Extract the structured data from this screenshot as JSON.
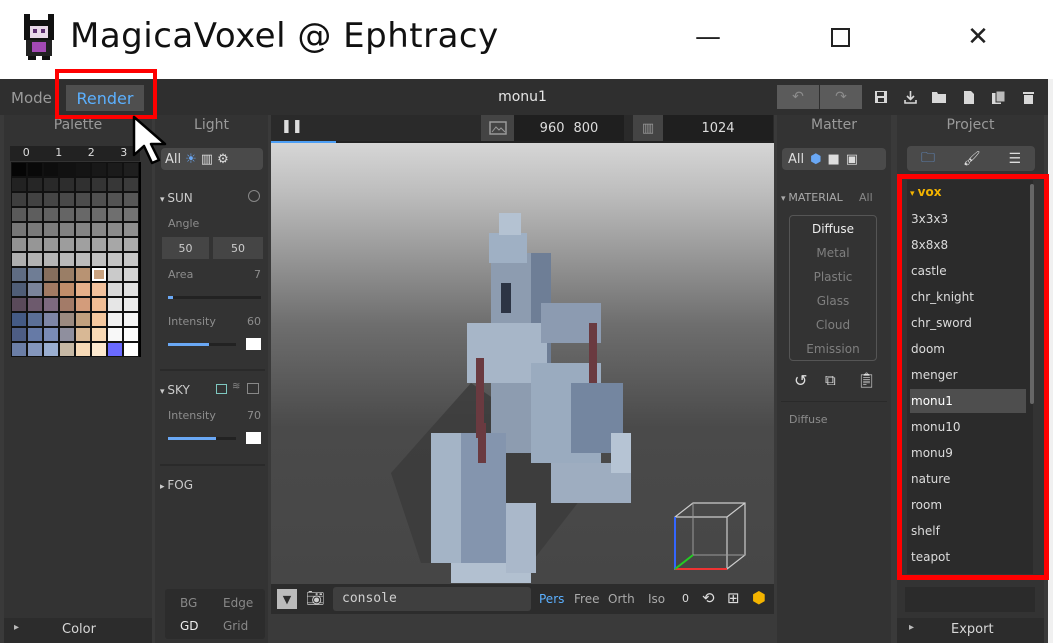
{
  "window": {
    "title": "MagicaVoxel @ Ephtracy",
    "min_icon": "minimize-icon",
    "max_icon": "maximize-icon",
    "close_icon": "close-icon"
  },
  "topbar": {
    "mode_label": "Mode",
    "render_label": "Render",
    "doc_title": "monu1",
    "toolbar_icons": [
      "undo-icon",
      "redo-icon",
      "save-icon",
      "download-icon",
      "folder-icon",
      "new-file-icon",
      "copy-file-icon",
      "trash-icon"
    ]
  },
  "palette": {
    "title": "Palette",
    "page_numbers": [
      "0",
      "1",
      "2",
      "3"
    ],
    "footer_label": "Color",
    "colors": [
      "#050505",
      "#090909",
      "#0d0d0d",
      "#111",
      "#141414",
      "#181818",
      "#1b1b1b",
      "#1f1f1f",
      "#222",
      "#262626",
      "#292929",
      "#2d2d2d",
      "#303030",
      "#343434",
      "#373737",
      "#3b3b3b",
      "#3e3e3e",
      "#424242",
      "#454545",
      "#494949",
      "#4c4c4c",
      "#505050",
      "#535353",
      "#575757",
      "#5a5a5a",
      "#5e5e5e",
      "#616161",
      "#656565",
      "#686868",
      "#6c6c6c",
      "#6f6f6f",
      "#737373",
      "#767676",
      "#7a7a7a",
      "#7d7d7d",
      "#818181",
      "#848484",
      "#888",
      "#8b8b8b",
      "#8f8f8f",
      "#929292",
      "#969696",
      "#999",
      "#9d9d9d",
      "#a0a0a0",
      "#a4a4a4",
      "#a7a7a7",
      "#ababab",
      "#aeaeae",
      "#b2b2b2",
      "#b5b5b5",
      "#b9b9b9",
      "#bcbcbc",
      "#c0c0c0",
      "#c3c3c3",
      "#c7c7c7",
      "#5f6c82",
      "#6f7d95",
      "#866e5d",
      "#9a7e66",
      "#b89373",
      "#c9a27f",
      "#cacaca",
      "#d4d4d4",
      "#4f5d76",
      "#7b849a",
      "#a27a63",
      "#c08d6a",
      "#e6b08a",
      "#f2c19c",
      "#d9d9d9",
      "#e0e0e0",
      "#5a4a5a",
      "#6d5a6d",
      "#7d6a7f",
      "#a37b68",
      "#d39c7b",
      "#f0bd95",
      "#e6e6e6",
      "#ebebeb",
      "#445a84",
      "#5b6f96",
      "#7e86a6",
      "#9b8a80",
      "#c1a07e",
      "#f5c89f",
      "#f0f0f0",
      "#f4f4f4",
      "#4d5d84",
      "#667aa6",
      "#7a8bb5",
      "#8f8f9e",
      "#d8b895",
      "#f8d9b5",
      "#f8f8f8",
      "#fcfcfc",
      "#6b7ea6",
      "#8496bc",
      "#9aaed0",
      "#c6b8a4",
      "#f6d9b6",
      "#fde9cf",
      "#6a6aff",
      "#ffffff"
    ],
    "selected_index": 61
  },
  "light": {
    "title": "Light",
    "tab_all": "All",
    "sun": {
      "title": "SUN",
      "angle_label": "Angle",
      "angle1": "50",
      "angle2": "50",
      "area_label": "Area",
      "area_value": "7",
      "area_fraction": 0.05,
      "intensity_label": "Intensity",
      "intensity_value": "60",
      "intensity_fraction": 0.6
    },
    "sky": {
      "title": "SKY",
      "intensity_label": "Intensity",
      "intensity_value": "70",
      "intensity_fraction": 0.7
    },
    "fog": {
      "title": "FOG"
    },
    "bottom": {
      "bg": "BG",
      "edge": "Edge",
      "gd": "GD",
      "grid": "Grid"
    }
  },
  "viewport": {
    "size_w": "960",
    "size_h": "800",
    "samples": "1024",
    "progress_fraction": 0.13,
    "console_placeholder": "console",
    "cam_modes": [
      "Pers",
      "Free",
      "Orth",
      "Iso"
    ],
    "cam_value": "0"
  },
  "matter": {
    "title": "Matter",
    "tab_all": "All",
    "material_label": "MATERIAL",
    "material_all": "All",
    "materials": [
      "Diffuse",
      "Metal",
      "Plastic",
      "Glass",
      "Cloud",
      "Emission"
    ],
    "selected": "Diffuse",
    "footer_label": "Diffuse"
  },
  "project": {
    "title": "Project",
    "folder_label": "vox",
    "items": [
      "3x3x3",
      "8x8x8",
      "castle",
      "chr_knight",
      "chr_sword",
      "doom",
      "menger",
      "monu1",
      "monu10",
      "monu9",
      "nature",
      "room",
      "shelf",
      "teapot"
    ],
    "selected": "monu1",
    "export_label": "Export"
  }
}
